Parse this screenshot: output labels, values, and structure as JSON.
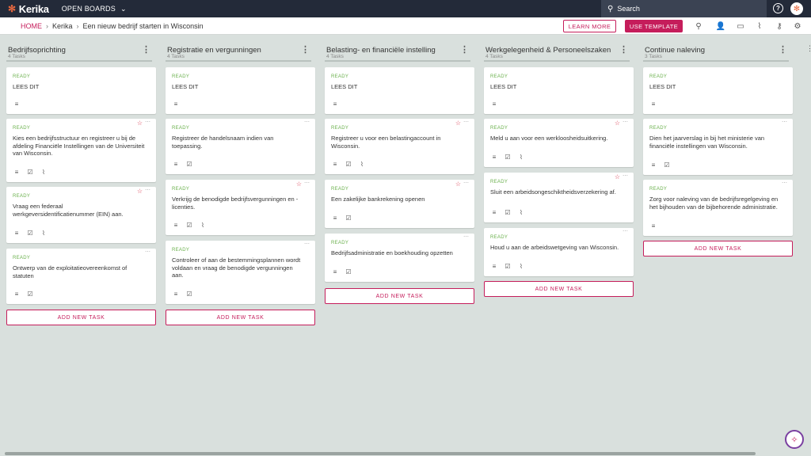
{
  "app": {
    "name": "Kerika",
    "open_boards": "OPEN BOARDS"
  },
  "search": {
    "placeholder": "Search"
  },
  "breadcrumb": {
    "home": "HOME",
    "account": "Kerika",
    "board": "Een nieuw bedrijf starten in Wisconsin"
  },
  "actions": {
    "learn_more": "LEARN MORE",
    "use_template": "USE TEMPLATE"
  },
  "colors": {
    "accent": "#c51d5b",
    "ready": "#6ab04c",
    "topbar": "#232a39"
  },
  "columns": [
    {
      "title": "Bedrijfsoprichting",
      "count": "4 Tasks",
      "cards": [
        {
          "status": "READY",
          "title": "LEES DIT",
          "star": false,
          "icons": [
            "notes-icon"
          ]
        },
        {
          "status": "READY",
          "title": "Kies een bedrijfsstructuur en registreer u bij de afdeling Financiële Instellingen van de Universiteit van Wisconsin.",
          "star": true,
          "icons": [
            "notes-icon",
            "checklist-icon",
            "attachment-icon"
          ]
        },
        {
          "status": "READY",
          "title": "Vraag een federaal werkgeversidentificatienummer (EIN) aan.",
          "star": true,
          "icons": [
            "notes-icon",
            "checklist-icon",
            "attachment-icon"
          ]
        },
        {
          "status": "READY",
          "title": "Ontwerp van de exploitatieovereenkomst of statuten",
          "star": false,
          "icons": [
            "notes-icon",
            "checklist-icon"
          ]
        }
      ],
      "add_label": "ADD NEW TASK"
    },
    {
      "title": "Registratie en vergunningen",
      "count": "4 Tasks",
      "cards": [
        {
          "status": "READY",
          "title": "LEES DIT",
          "star": false,
          "icons": [
            "notes-icon"
          ]
        },
        {
          "status": "READY",
          "title": "Registreer de handelsnaam indien van toepassing.",
          "star": false,
          "icons": [
            "notes-icon",
            "checklist-icon"
          ]
        },
        {
          "status": "READY",
          "title": "Verkrijg de benodigde bedrijfsvergunningen en -licenties.",
          "star": true,
          "icons": [
            "notes-icon",
            "checklist-icon",
            "attachment-icon"
          ]
        },
        {
          "status": "READY",
          "title": "Controleer of aan de bestemmingsplannen wordt voldaan en vraag de benodigde vergunningen aan.",
          "star": false,
          "icons": [
            "notes-icon",
            "checklist-icon"
          ]
        }
      ],
      "add_label": "ADD NEW TASK"
    },
    {
      "title": "Belasting- en financiële instelling",
      "count": "4 Tasks",
      "cards": [
        {
          "status": "READY",
          "title": "LEES DIT",
          "star": false,
          "icons": [
            "notes-icon"
          ]
        },
        {
          "status": "READY",
          "title": "Registreer u voor een belastingaccount in Wisconsin.",
          "star": true,
          "icons": [
            "notes-icon",
            "checklist-icon",
            "attachment-icon"
          ]
        },
        {
          "status": "READY",
          "title": "Een zakelijke bankrekening openen",
          "star": true,
          "icons": [
            "notes-icon",
            "checklist-icon"
          ]
        },
        {
          "status": "READY",
          "title": "Bedrijfsadministratie en boekhouding opzetten",
          "star": false,
          "icons": [
            "notes-icon",
            "checklist-icon"
          ]
        }
      ],
      "add_label": "ADD NEW TASK"
    },
    {
      "title": "Werkgelegenheid & Personeelszaken",
      "count": "4 Tasks",
      "cards": [
        {
          "status": "READY",
          "title": "LEES DIT",
          "star": false,
          "icons": [
            "notes-icon"
          ]
        },
        {
          "status": "READY",
          "title": "Meld u aan voor een werkloosheidsuitkering.",
          "star": true,
          "icons": [
            "notes-icon",
            "checklist-icon",
            "attachment-icon"
          ]
        },
        {
          "status": "READY",
          "title": "Sluit een arbeidsongeschiktheidsverzekering af.",
          "star": true,
          "icons": [
            "notes-icon",
            "checklist-icon",
            "attachment-icon"
          ]
        },
        {
          "status": "READY",
          "title": "Houd u aan de arbeidswetgeving van Wisconsin.",
          "star": false,
          "icons": [
            "notes-icon",
            "checklist-icon",
            "attachment-icon"
          ]
        }
      ],
      "add_label": "ADD NEW TASK"
    },
    {
      "title": "Continue naleving",
      "count": "3 Tasks",
      "cards": [
        {
          "status": "READY",
          "title": "LEES DIT",
          "star": false,
          "icons": [
            "notes-icon"
          ]
        },
        {
          "status": "READY",
          "title": "Dien het jaarverslag in bij het ministerie van financiële instellingen van Wisconsin.",
          "star": false,
          "icons": [
            "notes-icon",
            "checklist-icon"
          ]
        },
        {
          "status": "READY",
          "title": "Zorg voor naleving van de bedrijfsregelgeving en het bijhouden van de bijbehorende administratie.",
          "star": false,
          "icons": [
            "notes-icon"
          ]
        }
      ],
      "add_label": "ADD NEW TASK"
    }
  ]
}
